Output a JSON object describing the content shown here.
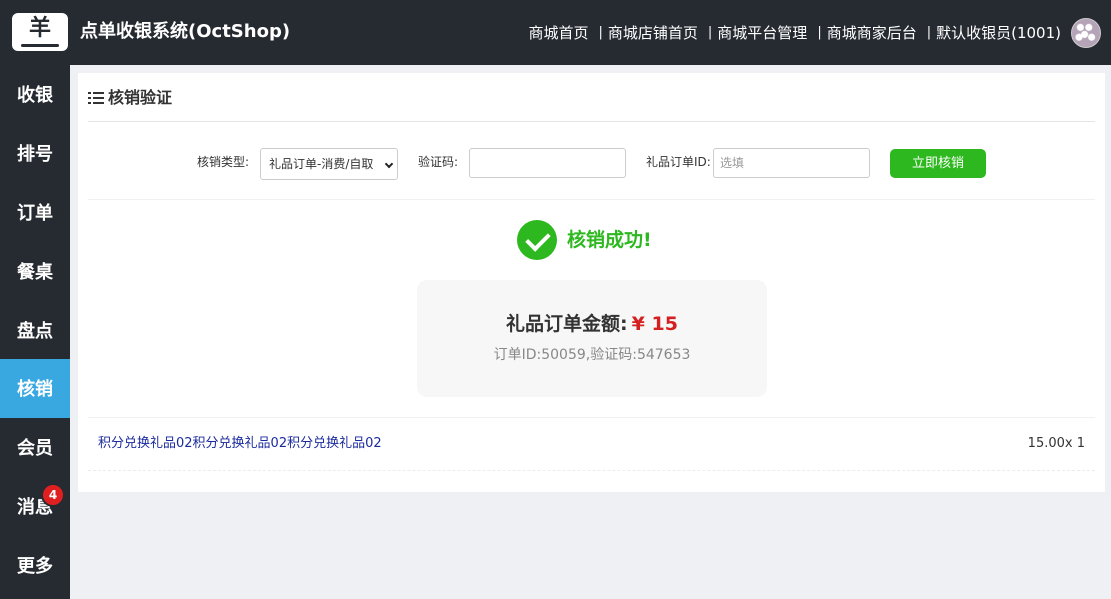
{
  "header": {
    "logo_glyph": "羊",
    "app_title": "点单收银系统(OctShop)",
    "nav": [
      "商城首页",
      "商城店铺首页",
      "商城平台管理",
      "商城商家后台",
      "默认收银员(1001)"
    ]
  },
  "sidebar": {
    "items": [
      {
        "label": "收银"
      },
      {
        "label": "排号"
      },
      {
        "label": "订单"
      },
      {
        "label": "餐桌"
      },
      {
        "label": "盘点"
      },
      {
        "label": "核销",
        "active": true
      },
      {
        "label": "会员"
      },
      {
        "label": "消息",
        "badge": "4"
      },
      {
        "label": "更多"
      }
    ]
  },
  "panel": {
    "title": "核销验证"
  },
  "form": {
    "type_label": "核销类型:",
    "type_value": "礼品订单-消费/自取",
    "code_label": "验证码:",
    "code_value": "",
    "order_label": "礼品订单ID:",
    "order_placeholder": "选填",
    "submit_label": "立即核销"
  },
  "result": {
    "success_text": "核销成功!",
    "amount_label": "礼品订单金额:",
    "amount_value": "¥ 15",
    "meta": "订单ID:50059,验证码:547653"
  },
  "items": [
    {
      "name": "积分兑换礼品02积分兑换礼品02积分兑换礼品02",
      "qty": "15.00x 1"
    }
  ],
  "colors": {
    "topbar": "#262a31",
    "active_nav": "#3aa8e0",
    "success": "#2db81f",
    "amount": "#d42020",
    "badge": "#e02020",
    "item_link": "#1a2a9e"
  }
}
